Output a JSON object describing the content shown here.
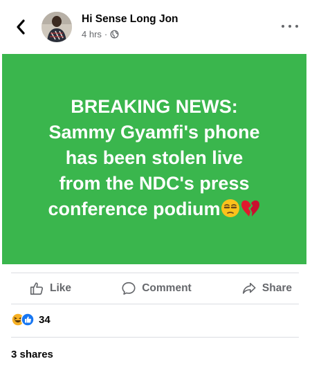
{
  "header": {
    "poster_name": "Hi Sense Long Jon",
    "time": "4 hrs",
    "separator": "·",
    "audience_icon": "globe-icon",
    "back_icon": "chevron-left-icon",
    "more_icon": "more-horizontal-icon"
  },
  "post": {
    "background_color": "#3ab64d",
    "text_color": "#ffffff",
    "lines": [
      "BREAKING NEWS:",
      "Sammy Gyamfi's phone",
      "has been stolen live",
      "from the NDC's press",
      "conference podium"
    ],
    "emojis": [
      "unamused-face-emoji",
      "broken-heart-emoji"
    ]
  },
  "actions": {
    "like_label": "Like",
    "comment_label": "Comment",
    "share_label": "Share"
  },
  "reactions": {
    "icons": [
      "haha-reaction-icon",
      "like-reaction-icon"
    ],
    "count": "34"
  },
  "shares": {
    "label": "3 shares"
  }
}
